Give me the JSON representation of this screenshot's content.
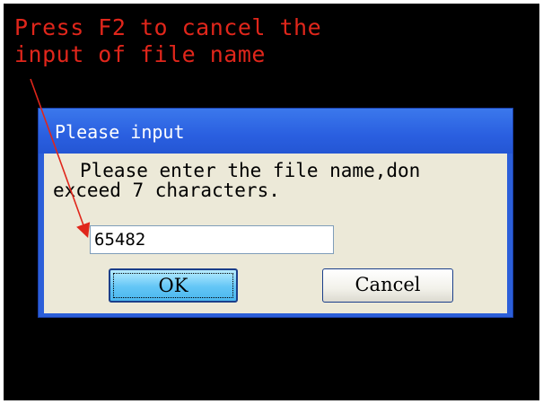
{
  "annotation": {
    "line1": "Press F2 to cancel the",
    "line2": "input of file name",
    "color": "#e0261b"
  },
  "dialog": {
    "title": "Please input",
    "message_line1": "Please enter the file name,don",
    "message_line2": "exceed 7 characters.",
    "input_value": "65482",
    "ok_label": "OK",
    "cancel_label": "Cancel",
    "title_bar_color": "#2c5fd9",
    "client_color": "#ece9d8"
  }
}
